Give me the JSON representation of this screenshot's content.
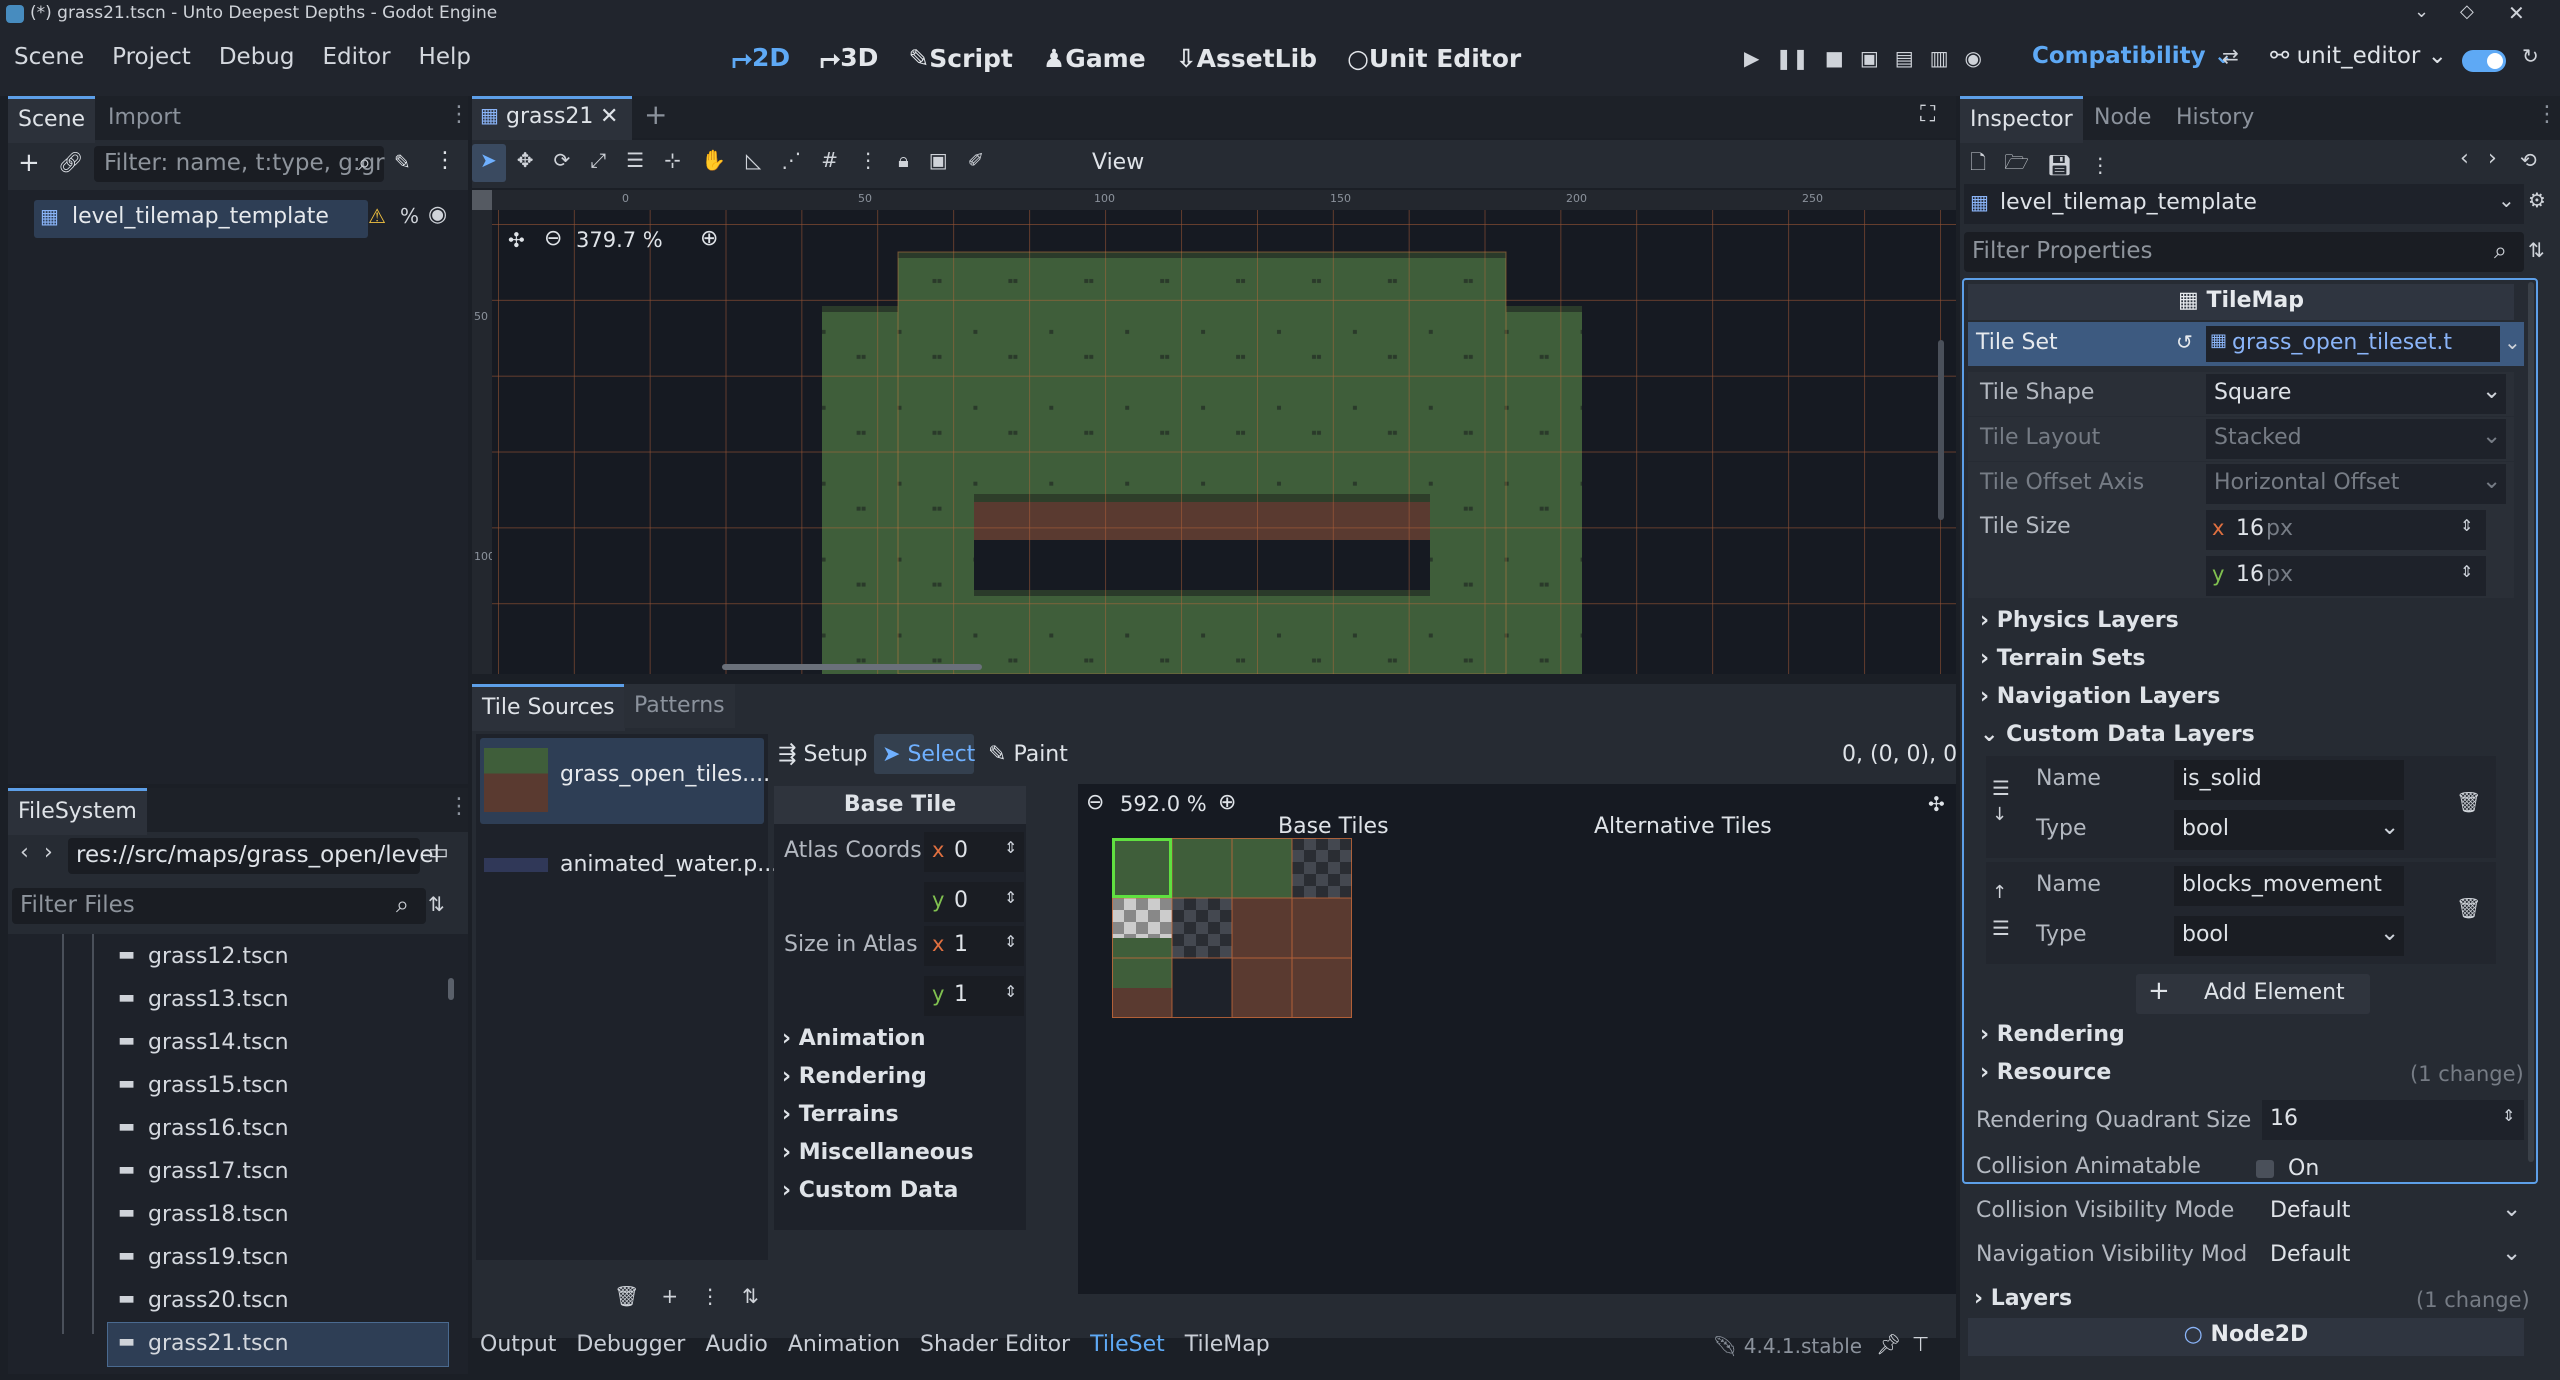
{
  "window": {
    "title": "(*) grass21.tscn - Unto Deepest Depths - Godot Engine"
  },
  "menu": [
    "Scene",
    "Project",
    "Debug",
    "Editor",
    "Help"
  ],
  "workspaces": [
    {
      "label": "2D",
      "active": true,
      "icon": "2d-icon"
    },
    {
      "label": "3D",
      "icon": "3d-icon"
    },
    {
      "label": "Script",
      "icon": "script-icon"
    },
    {
      "label": "Game",
      "icon": "game-icon"
    },
    {
      "label": "AssetLib",
      "icon": "assetlib-icon"
    },
    {
      "label": "Unit Editor",
      "icon": "unit-editor-icon"
    }
  ],
  "toolbar_right": {
    "renderer": "Compatibility",
    "profile": "unit_editor"
  },
  "scene_panel": {
    "tabs": [
      "Scene",
      "Import"
    ],
    "filter_placeholder": "Filter: name, t:type, g:gr",
    "root_node": "level_tilemap_template"
  },
  "filesystem": {
    "tab": "FileSystem",
    "path": "res://src/maps/grass_open/level",
    "filter_placeholder": "Filter Files",
    "files": [
      "grass12.tscn",
      "grass13.tscn",
      "grass14.tscn",
      "grass15.tscn",
      "grass16.tscn",
      "grass17.tscn",
      "grass18.tscn",
      "grass19.tscn",
      "grass20.tscn",
      "grass21.tscn"
    ],
    "selected": "grass21.tscn"
  },
  "editor_tabs": {
    "active": "grass21"
  },
  "viewport": {
    "zoom": "379.7 %",
    "view_menu": "View",
    "ruler": [
      "0",
      "50",
      "100",
      "150",
      "200",
      "250"
    ],
    "vruler": [
      "50",
      "100"
    ]
  },
  "tileset_panel": {
    "tabs": [
      "Tile Sources",
      "Patterns"
    ],
    "sources": [
      "grass_open_tiles....",
      "animated_water.p..."
    ],
    "modes": [
      "Setup",
      "Select",
      "Paint"
    ],
    "active_mode": "Select",
    "coords": "0, (0, 0), 0",
    "base_tile": {
      "title": "Base Tile",
      "atlas_coords_label": "Atlas Coords",
      "atlas_x": "0",
      "atlas_y": "0",
      "size_label": "Size in Atlas",
      "size_x": "1",
      "size_y": "1",
      "sections": [
        "Animation",
        "Rendering",
        "Terrains",
        "Miscellaneous",
        "Custom Data"
      ]
    },
    "atlas_zoom": "592.0 %",
    "base_tiles_label": "Base Tiles",
    "alt_tiles_label": "Alternative Tiles"
  },
  "bottom_tabs": [
    "Output",
    "Debugger",
    "Audio",
    "Animation",
    "Shader Editor",
    "TileSet",
    "TileMap"
  ],
  "bottom_active": "TileSet",
  "version": "4.4.1.stable",
  "inspector": {
    "tabs": [
      "Inspector",
      "Node",
      "History"
    ],
    "node": "level_tilemap_template",
    "filter_placeholder": "Filter Properties",
    "class": "TileMap",
    "tile_set_label": "Tile Set",
    "tile_set_value": "grass_open_tileset.t",
    "props": [
      {
        "label": "Tile Shape",
        "value": "Square"
      },
      {
        "label": "Tile Layout",
        "value": "Stacked"
      },
      {
        "label": "Tile Offset Axis",
        "value": "Horizontal Offset"
      }
    ],
    "tile_size_label": "Tile Size",
    "tile_size_x": "16",
    "tile_size_y": "16",
    "px": "px",
    "sections1": [
      "Physics Layers",
      "Terrain Sets",
      "Navigation Layers"
    ],
    "custom_data": "Custom Data Layers",
    "layers": [
      {
        "name_label": "Name",
        "name": "is_solid",
        "type_label": "Type",
        "type": "bool"
      },
      {
        "name_label": "Name",
        "name": "blocks_movement",
        "type_label": "Type",
        "type": "bool"
      }
    ],
    "add_element": "Add Element",
    "rendering": "Rendering",
    "resource": "Resource",
    "resource_change": "(1 change)",
    "rqs_label": "Rendering Quadrant Size",
    "rqs_value": "16",
    "ca_label": "Collision Animatable",
    "ca_value": "On",
    "cvm_label": "Collision Visibility Mode",
    "cvm_value": "Default",
    "nvm_label": "Navigation Visibility Mod",
    "nvm_value": "Default",
    "layers_section": "Layers",
    "layers_change": "(1 change)",
    "node2d": "Node2D"
  }
}
